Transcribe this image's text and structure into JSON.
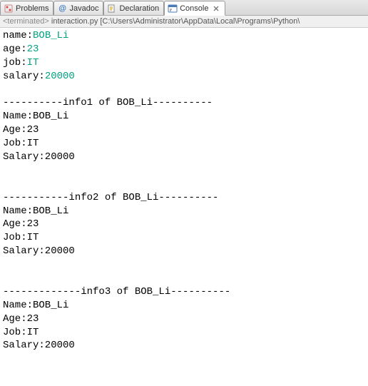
{
  "tabs": [
    {
      "label": "Problems"
    },
    {
      "label": "Javadoc"
    },
    {
      "label": "Declaration"
    },
    {
      "label": "Console"
    }
  ],
  "console_header": {
    "status": "<terminated>",
    "path": "interaction.py [C:\\Users\\Administrator\\AppData\\Local\\Programs\\Python\\"
  },
  "output": {
    "prompts": [
      {
        "label": "name:",
        "value": "BOB_Li"
      },
      {
        "label": "age:",
        "value": "23"
      },
      {
        "label": "job:",
        "value": "IT"
      },
      {
        "label": "salary:",
        "value": "20000"
      }
    ],
    "sections": [
      {
        "header": "----------info1 of BOB_Li----------",
        "lines": [
          "Name:BOB_Li",
          "Age:23",
          "Job:IT",
          "Salary:20000"
        ]
      },
      {
        "header": "-----------info2 of BOB_Li----------",
        "lines": [
          "Name:BOB_Li",
          "Age:23",
          "Job:IT",
          "Salary:20000"
        ]
      },
      {
        "header": "-------------info3 of BOB_Li----------",
        "lines": [
          "Name:BOB_Li",
          "Age:23",
          "Job:IT",
          "Salary:20000"
        ]
      }
    ]
  }
}
